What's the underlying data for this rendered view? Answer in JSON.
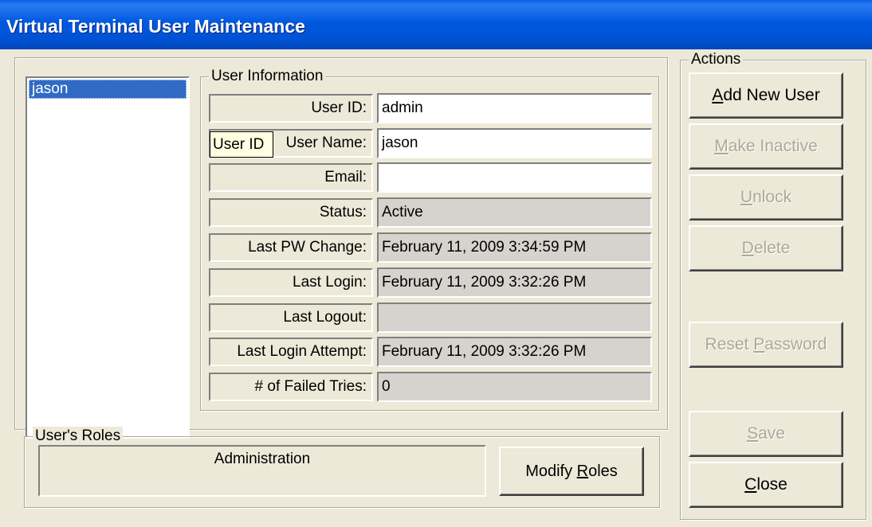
{
  "window": {
    "title": "Virtual Terminal User Maintenance"
  },
  "users_list": {
    "items": [
      "jason"
    ],
    "selected": "jason"
  },
  "user_info": {
    "group_title": "User Information",
    "tooltip": "User ID",
    "fields": [
      {
        "label": "User ID:",
        "value": "admin",
        "editable": true
      },
      {
        "label": "User Name:",
        "value": "jason",
        "editable": true
      },
      {
        "label": "Email:",
        "value": "",
        "editable": true
      },
      {
        "label": "Status:",
        "value": "Active",
        "editable": false
      },
      {
        "label": "Last PW Change:",
        "value": "February 11, 2009 3:34:59 PM",
        "editable": false
      },
      {
        "label": "Last Login:",
        "value": "February 11, 2009 3:32:26 PM",
        "editable": false
      },
      {
        "label": "Last Logout:",
        "value": "",
        "editable": false
      },
      {
        "label": "Last Login Attempt:",
        "value": "February 11, 2009 3:32:26 PM",
        "editable": false
      },
      {
        "label": "# of Failed Tries:",
        "value": "0",
        "editable": false
      }
    ]
  },
  "roles": {
    "group_title": "User's Roles",
    "value": "Administration",
    "modify_button": {
      "label": "Modify Roles",
      "underline": "R"
    }
  },
  "actions": {
    "group_title": "Actions",
    "buttons": [
      {
        "label": "Add New User",
        "underline": "A",
        "enabled": true
      },
      {
        "label": "Make Inactive",
        "underline": "M",
        "enabled": false
      },
      {
        "label": "Unlock",
        "underline": "U",
        "enabled": false
      },
      {
        "label": "Delete",
        "underline": "D",
        "enabled": false
      },
      {
        "label": "Reset Password",
        "underline": "P",
        "enabled": false
      },
      {
        "label": "Save",
        "underline": "S",
        "enabled": false
      },
      {
        "label": "Close",
        "underline": "C",
        "enabled": true
      }
    ]
  },
  "colors": {
    "titlebar": "#0054e3",
    "face": "#ece9d8",
    "selection": "#316ac5",
    "readonly_field": "#d6d3ce",
    "disabled_text": "#aca899"
  }
}
